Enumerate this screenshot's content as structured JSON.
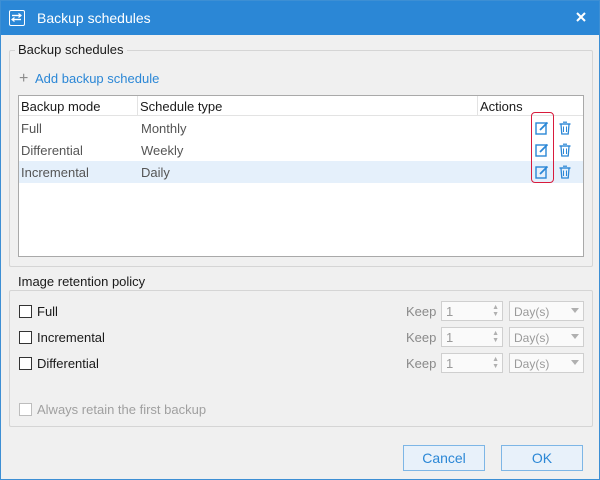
{
  "window": {
    "title": "Backup schedules",
    "accent_color": "#2b87d6",
    "icon": "backup-schedule-icon",
    "close_icon": "close-icon"
  },
  "schedules": {
    "group_title": "Backup schedules",
    "add_label": "Add backup schedule",
    "columns": [
      "Backup mode",
      "Schedule type",
      "Actions"
    ],
    "rows": [
      {
        "mode": "Full",
        "type": "Monthly",
        "selected": false
      },
      {
        "mode": "Differential",
        "type": "Weekly",
        "selected": false
      },
      {
        "mode": "Incremental",
        "type": "Daily",
        "selected": true
      }
    ],
    "highlight_color": "#d81b3c"
  },
  "retention": {
    "group_title": "Image retention policy",
    "items": [
      {
        "label": "Full",
        "keep_label": "Keep",
        "value": "1",
        "unit": "Day(s)"
      },
      {
        "label": "Incremental",
        "keep_label": "Keep",
        "value": "1",
        "unit": "Day(s)"
      },
      {
        "label": "Differential",
        "keep_label": "Keep",
        "value": "1",
        "unit": "Day(s)"
      }
    ],
    "always_retain_label": "Always retain the first backup"
  },
  "buttons": {
    "cancel": "Cancel",
    "ok": "OK"
  }
}
